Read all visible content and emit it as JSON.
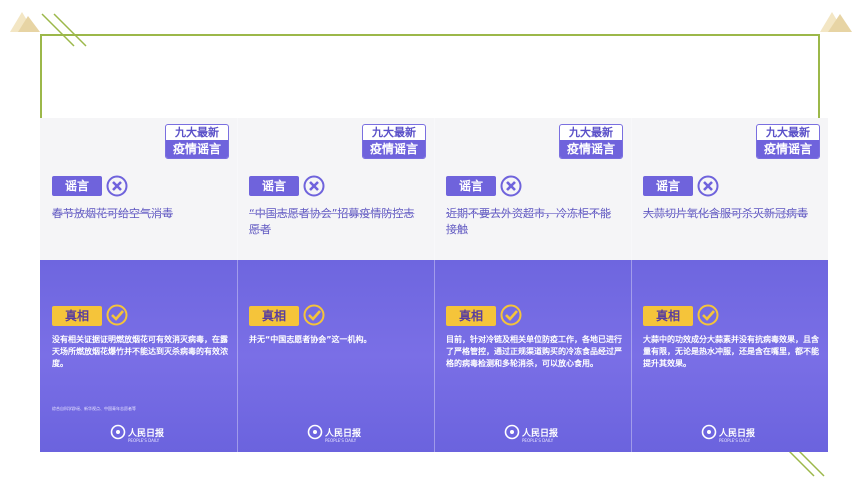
{
  "colors": {
    "frame": "#9cb84a",
    "accent": "#6f63dc",
    "truth": "#f5c43a"
  },
  "cards": [
    {
      "badge_line1": "九大最新",
      "badge_line2": "疫情谣言",
      "rumor_label": "谣言",
      "rumor_text": "春节放烟花可给空气消毒",
      "truth_label": "真相",
      "truth_text": "没有相关证据证明燃放烟花可有效消灭病毒，在露天场所燃放烟花爆竹并不能达到灭杀病毒的有效浓度。",
      "source": "综合自科学辟谣、新华视点、中国青年志愿者等",
      "logo_text": "人民日报",
      "logo_sub": "PEOPLE'S DAILY"
    },
    {
      "badge_line1": "九大最新",
      "badge_line2": "疫情谣言",
      "rumor_label": "谣言",
      "rumor_text": "“中国志愿者协会”招募疫情防控志愿者",
      "truth_label": "真相",
      "truth_text": "并无“中国志愿者协会”这一机构。",
      "source": "",
      "logo_text": "人民日报",
      "logo_sub": "PEOPLE'S DAILY"
    },
    {
      "badge_line1": "九大最新",
      "badge_line2": "疫情谣言",
      "rumor_label": "谣言",
      "rumor_text": "近期不要去外资超市，冷冻柜不能接触",
      "truth_label": "真相",
      "truth_text": "目前，针对冷链及相关单位防疫工作，各地已进行了严格管控，通过正规渠道购买的冷冻食品经过严格的病毒检测和多轮消杀，可以放心食用。",
      "source": "",
      "logo_text": "人民日报",
      "logo_sub": "PEOPLE'S DAILY"
    },
    {
      "badge_line1": "九大最新",
      "badge_line2": "疫情谣言",
      "rumor_label": "谣言",
      "rumor_text": "大蒜切片氧化含服可杀灭新冠病毒",
      "truth_label": "真相",
      "truth_text": "大蒜中的功效成分大蒜素并没有抗病毒效果，且含量有限，无论是热水冲服，还是含在嘴里，都不能提升其效果。",
      "source": "",
      "logo_text": "人民日报",
      "logo_sub": "PEOPLE'S DAILY"
    }
  ]
}
